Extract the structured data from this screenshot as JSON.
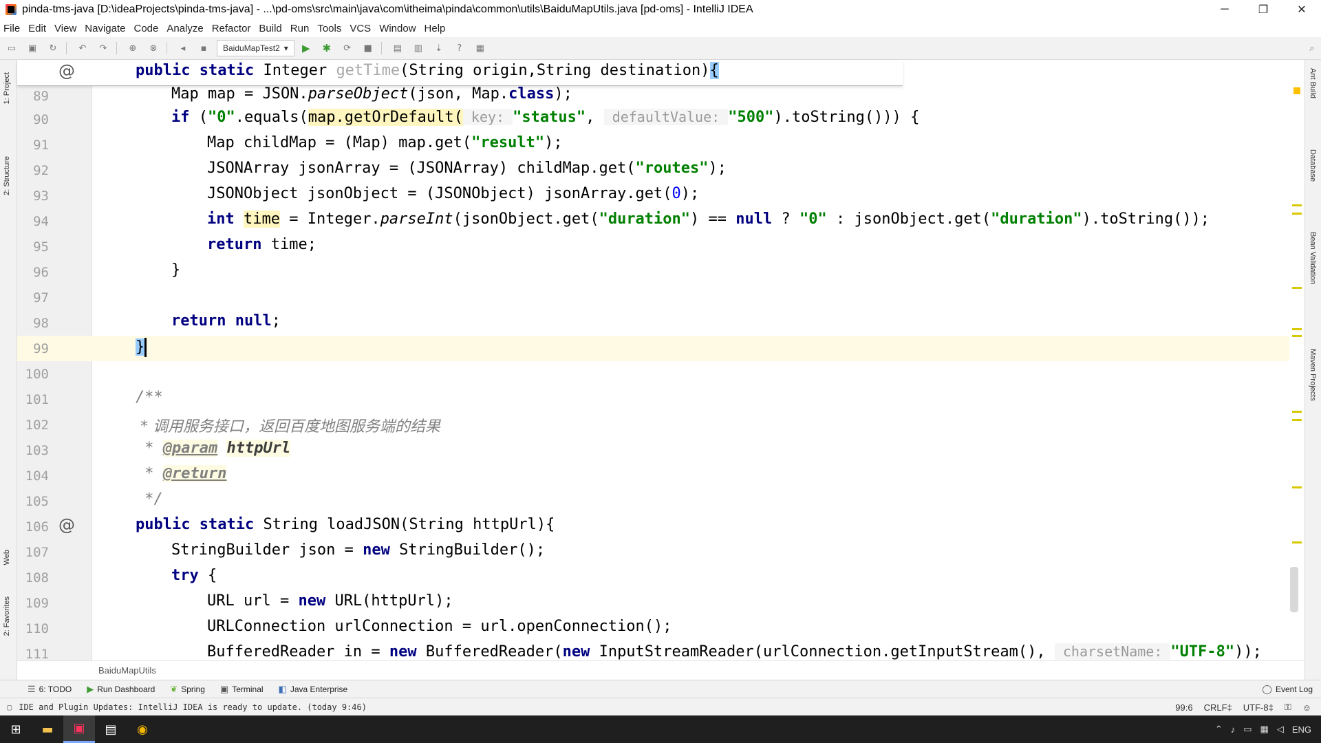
{
  "window": {
    "title": "pinda-tms-java [D:\\ideaProjects\\pinda-tms-java] - ...\\pd-oms\\src\\main\\java\\com\\itheima\\pinda\\common\\utils\\BaiduMapUtils.java [pd-oms] - IntelliJ IDEA",
    "minimize": "─",
    "restore": "❐",
    "close": "✕"
  },
  "menu": [
    "File",
    "Edit",
    "View",
    "Navigate",
    "Code",
    "Analyze",
    "Refactor",
    "Build",
    "Run",
    "Tools",
    "VCS",
    "Window",
    "Help"
  ],
  "toolbar": {
    "run_config": "BaiduMapTest2",
    "run_config_arrow": "▾",
    "search_icon": "⌕"
  },
  "left_tabs": [
    "1: Project",
    "2: Structure",
    "Web",
    "2: Favorites"
  ],
  "right_tabs": [
    "Ant Build",
    "Database",
    "Bean Validation",
    "Maven Projects"
  ],
  "sticky": {
    "kw1": "public",
    "kw2": "static",
    "type": "Integer",
    "method_dim": "getTime",
    "rest": "(String origin,String destination)",
    "brace": "{"
  },
  "code": {
    "l89": {
      "n": "89",
      "pre": "Map map = JSON.",
      "method": "parseObject",
      "post": "(json, Map.",
      "kw": "class",
      "end": ");"
    },
    "l90": {
      "n": "90",
      "kw": "if",
      "p1": " (",
      "s1": "\"0\"",
      "p2": ".equals(",
      "hl": "map.getOrDefault(",
      "h1": " key: ",
      "s2": "\"status\"",
      "comma": ",",
      "h2": " defaultValue: ",
      "s3": "\"500\"",
      "p3": ").toString())) {"
    },
    "l91": {
      "n": "91",
      "pre": "Map childMap = (Map) map.get(",
      "s1": "\"result\"",
      "end": ");"
    },
    "l92": {
      "n": "92",
      "pre": "JSONArray jsonArray = (JSONArray) childMap.get(",
      "s1": "\"routes\"",
      "end": ");"
    },
    "l93": {
      "n": "93",
      "pre": "JSONObject jsonObject = (JSONObject) jsonArray.get(",
      "num": "0",
      "end": ");"
    },
    "l94": {
      "n": "94",
      "kw": "int",
      "sp": " ",
      "var": "time",
      "p1": " = Integer.",
      "method": "parseInt",
      "p2": "(jsonObject.get(",
      "s1": "\"duration\"",
      "p3": ") == ",
      "kw2": "null",
      "p4": " ? ",
      "s2": "\"0\"",
      "p5": " : jsonObject.get(",
      "s3": "\"duration\"",
      "p6": ").toString());"
    },
    "l95": {
      "n": "95",
      "kw": "return",
      "post": " time;"
    },
    "l96": {
      "n": "96",
      "text": "}"
    },
    "l97": {
      "n": "97"
    },
    "l98": {
      "n": "98",
      "kw": "return",
      "sp": " ",
      "kw2": "null",
      "end": ";"
    },
    "l99": {
      "n": "99",
      "brace": "}"
    },
    "l100": {
      "n": "100"
    },
    "l101": {
      "n": "101",
      "text": "/**"
    },
    "l102": {
      "n": "102",
      "text": " * 调用服务接口，返回百度地图服务端的结果"
    },
    "l103": {
      "n": "103",
      "pre": " * ",
      "tag": "@param",
      "sp": " ",
      "val": "httpUrl"
    },
    "l104": {
      "n": "104",
      "pre": " * ",
      "tag": "@return"
    },
    "l105": {
      "n": "105",
      "text": " */"
    },
    "l106": {
      "n": "106",
      "kw1": "public",
      "sp1": " ",
      "kw2": "static",
      "post": " String loadJSON(String httpUrl){"
    },
    "l107": {
      "n": "107",
      "pre": "StringBuilder json = ",
      "kw": "new",
      "post": " StringBuilder();"
    },
    "l108": {
      "n": "108",
      "kw": "try",
      "post": " {"
    },
    "l109": {
      "n": "109",
      "pre": "URL url = ",
      "kw": "new",
      "post": " URL(httpUrl);"
    },
    "l110": {
      "n": "110",
      "text": "URLConnection urlConnection = url.openConnection();"
    },
    "l111": {
      "n": "111",
      "pre": "BufferedReader in = ",
      "kw": "new",
      "mid": " BufferedReader(",
      "kw2": "new",
      "post": " InputStreamReader(urlConnection.getInputStream(), ",
      "hint": " charsetName: ",
      "s1": "\"UTF-8\"",
      "end": "));"
    }
  },
  "breadcrumb": "BaiduMapUtils",
  "tool_tabs": [
    "6: TODO",
    "Run Dashboard",
    "Spring",
    "Terminal",
    "Java Enterprise"
  ],
  "event_log": "Event Log",
  "status": {
    "message": "IDE and Plugin Updates: IntelliJ IDEA is ready to update. (today 9:46)",
    "position": "99:6",
    "line_sep": "CRLF‡",
    "encoding": "UTF-8‡"
  },
  "taskbar": {
    "start": "⊞",
    "lang": "ENG"
  }
}
